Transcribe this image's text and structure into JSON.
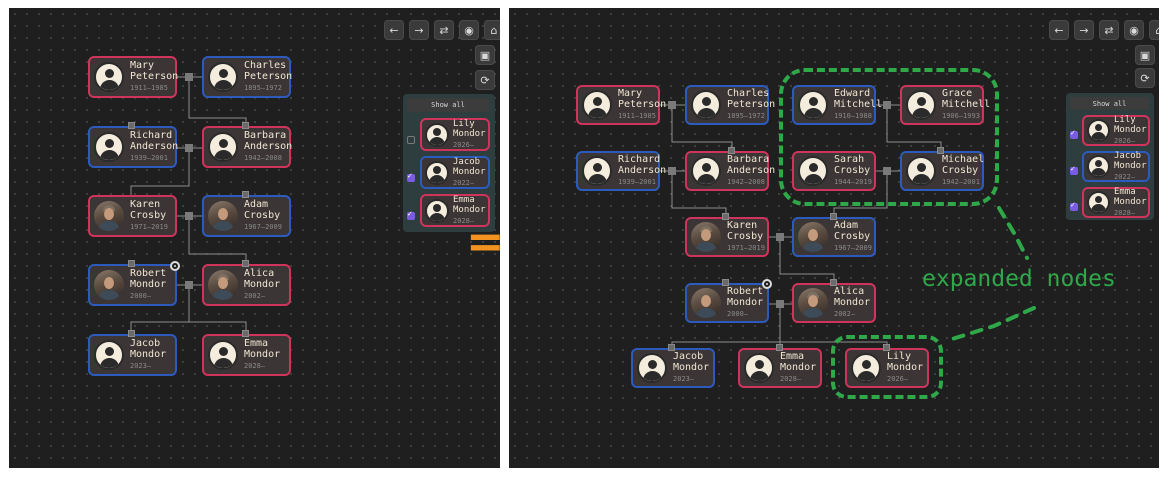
{
  "toolbar": {
    "back_icon": "←",
    "forward_icon": "→",
    "swap_icon": "⇄",
    "eye_icon": "◉",
    "home_icon": "⌂",
    "save_icon": "▣",
    "refresh_icon": "⟳"
  },
  "side_panel": {
    "show_all_label": "Show all"
  },
  "people": {
    "mary": {
      "first": "Mary",
      "last": "Peterson",
      "years": "1911–1985"
    },
    "charles": {
      "first": "Charles",
      "last": "Peterson",
      "years": "1895–1972"
    },
    "richard": {
      "first": "Richard",
      "last": "Anderson",
      "years": "1939–2001"
    },
    "barbara": {
      "first": "Barbara",
      "last": "Anderson",
      "years": "1942–2008"
    },
    "karen": {
      "first": "Karen",
      "last": "Crosby",
      "years": "1971–2019"
    },
    "adam": {
      "first": "Adam",
      "last": "Crosby",
      "years": "1967–2009"
    },
    "robert": {
      "first": "Robert",
      "last": "Mondor",
      "years": "2000–"
    },
    "alica": {
      "first": "Alica",
      "last": "Mondor",
      "years": "2002–"
    },
    "jacob": {
      "first": "Jacob",
      "last": "Mondor",
      "years": "2023–"
    },
    "emma": {
      "first": "Emma",
      "last": "Mondor",
      "years": "2028–"
    },
    "lily": {
      "first": "Lily",
      "last": "Mondor",
      "years": "2026–"
    },
    "edward": {
      "first": "Edward",
      "last": "Mitchell",
      "years": "1910–1988"
    },
    "grace": {
      "first": "Grace",
      "last": "Mitchell",
      "years": "1906–1993"
    },
    "sarah": {
      "first": "Sarah",
      "last": "Crosby",
      "years": "1944–2019"
    },
    "michael": {
      "first": "Michael",
      "last": "Crosby",
      "years": "1942–2001"
    }
  },
  "side_people": {
    "lily": {
      "first": "Lily",
      "last": "Mondor",
      "years": "2026–"
    },
    "jacob": {
      "first": "Jacob",
      "last": "Mondor",
      "years": "2022–"
    },
    "emma": {
      "first": "Emma",
      "last": "Mondor",
      "years": "2028–"
    }
  },
  "annotation": {
    "arrow": "=>",
    "label": "expanded nodes"
  },
  "colors": {
    "male": "#2c5bbd",
    "female": "#d0345c",
    "accent": "#7a5ce0",
    "annotation": "#2fa84a",
    "arrow": "#f29321"
  }
}
